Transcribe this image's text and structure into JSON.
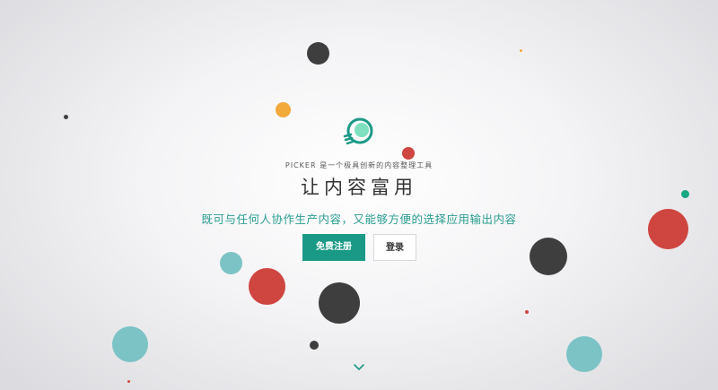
{
  "brand": {
    "tagline": "PICKER 是一个极具创新的内容整理工具",
    "logo_icon": "lightbulb-icon",
    "accent_color": "#1a9a86"
  },
  "hero": {
    "headline": "让内容富用",
    "subheadline": "既可与任何人协作生产内容，又能够方便的选择应用输出内容"
  },
  "actions": {
    "register_label": "免费注册",
    "login_label": "登录"
  },
  "scroll": {
    "icon": "chevron-down-icon"
  },
  "palette": {
    "dark": "#3e3e3e",
    "red": "#cf4540",
    "teal": "#7cc3c5",
    "orange": "#f2aa3a",
    "green": "#18a883"
  }
}
